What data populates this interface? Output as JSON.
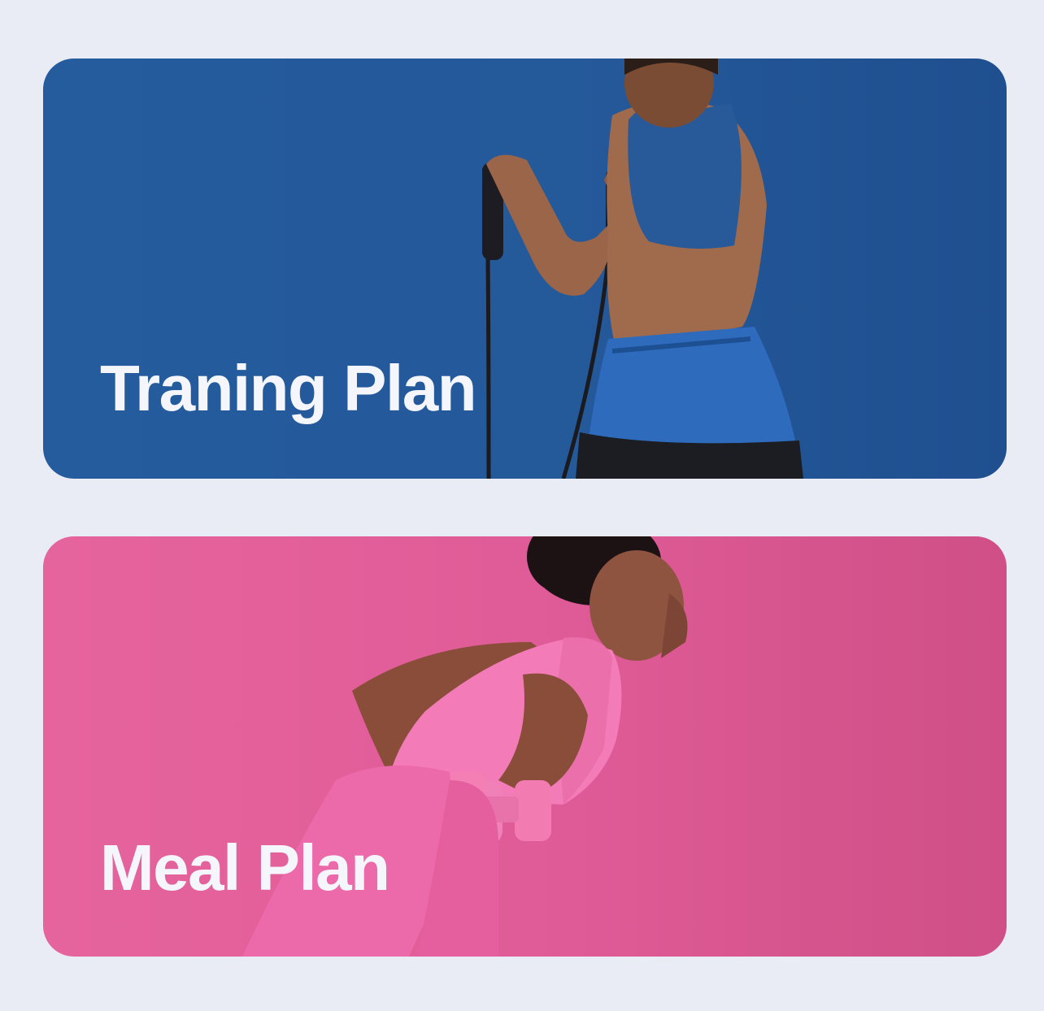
{
  "cards": [
    {
      "title": "Traning Plan",
      "photo": "woman-resistance-band-training-photo",
      "background_color": "#245c9e"
    },
    {
      "title": "Meal Plan",
      "photo": "woman-dumbbell-row-photo",
      "background_color": "#e6649e"
    }
  ]
}
